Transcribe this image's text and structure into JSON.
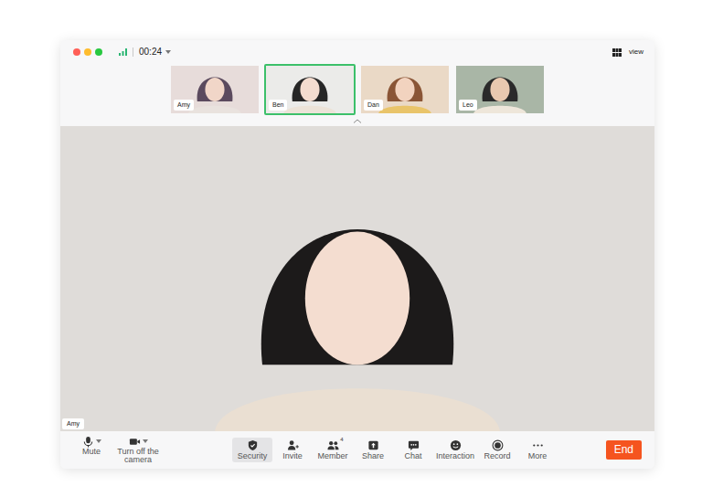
{
  "window": {
    "traffic_lights": [
      {
        "color": "#ff5f57"
      },
      {
        "color": "#febc2e"
      },
      {
        "color": "#28c840"
      }
    ]
  },
  "top_bar": {
    "timer": "00:24",
    "timer_has_menu": true,
    "view_label": "view"
  },
  "participants": [
    {
      "name": "Amy",
      "selected": false
    },
    {
      "name": "Ben",
      "selected": true
    },
    {
      "name": "Dan",
      "selected": false
    },
    {
      "name": "Leo",
      "selected": false
    }
  ],
  "main_video": {
    "name": "Amy"
  },
  "device_controls": [
    {
      "label": "Mute",
      "has_menu": true
    },
    {
      "label": "Turn off the camera",
      "has_menu": true
    }
  ],
  "meeting_controls": [
    {
      "label": "Security",
      "selected": true
    },
    {
      "label": "Invite",
      "selected": false
    },
    {
      "label": "Member",
      "selected": false,
      "badge": "4"
    },
    {
      "label": "Share",
      "selected": false
    },
    {
      "label": "Chat",
      "selected": false
    },
    {
      "label": "Interaction",
      "selected": false
    },
    {
      "label": "Record",
      "selected": false
    },
    {
      "label": "More",
      "selected": false
    }
  ],
  "end_button": "End"
}
